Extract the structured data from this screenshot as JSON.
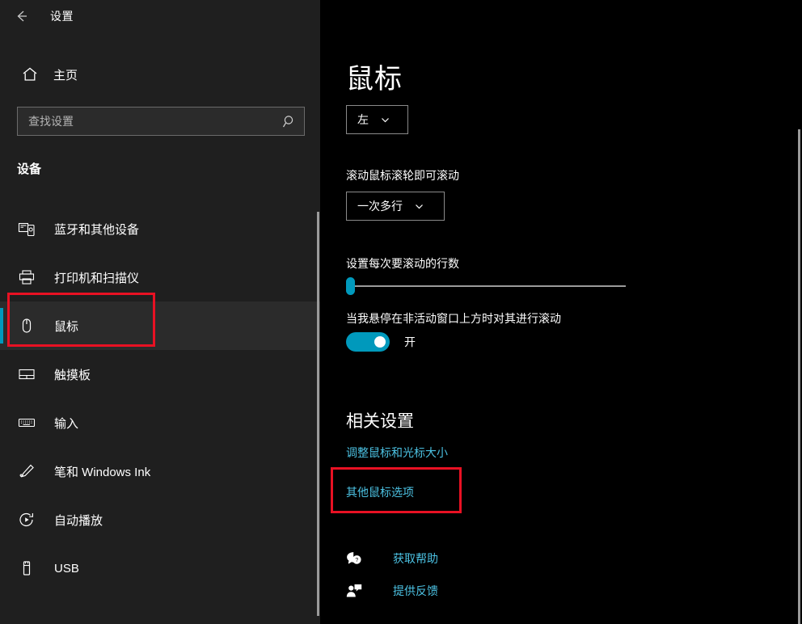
{
  "window": {
    "app_title": "设置",
    "back_icon": "back-arrow-icon",
    "controls": {
      "minimize": "minimize-icon",
      "maximize": "maximize-icon",
      "close": "close-icon"
    }
  },
  "sidebar": {
    "home": {
      "label": "主页",
      "icon": "home-icon"
    },
    "search": {
      "placeholder": "查找设置",
      "value": "",
      "icon": "search-icon"
    },
    "section_title": "设备",
    "items": [
      {
        "label": "蓝牙和其他设备",
        "icon": "bluetooth-devices-icon",
        "selected": false
      },
      {
        "label": "打印机和扫描仪",
        "icon": "printer-icon",
        "selected": false
      },
      {
        "label": "鼠标",
        "icon": "mouse-icon",
        "selected": true
      },
      {
        "label": "触摸板",
        "icon": "touchpad-icon",
        "selected": false
      },
      {
        "label": "输入",
        "icon": "keyboard-icon",
        "selected": false
      },
      {
        "label": "笔和 Windows Ink",
        "icon": "pen-icon",
        "selected": false
      },
      {
        "label": "自动播放",
        "icon": "autoplay-icon",
        "selected": false
      },
      {
        "label": "USB",
        "icon": "usb-icon",
        "selected": false
      }
    ]
  },
  "main": {
    "page_title": "鼠标",
    "primary_button": {
      "value": "左",
      "chevron": "chevron-down-icon"
    },
    "scroll_mouse_wheel": {
      "label": "滚动鼠标滚轮即可滚动",
      "value": "一次多行",
      "chevron": "chevron-down-icon"
    },
    "scroll_lines": {
      "label": "设置每次要滚动的行数",
      "slider_percent": 0
    },
    "inactive_window_scroll": {
      "label": "当我悬停在非活动窗口上方时对其进行滚动",
      "state": "开",
      "on": true
    },
    "related_settings": {
      "heading": "相关设置",
      "links": [
        "调整鼠标和光标大小",
        "其他鼠标选项"
      ]
    },
    "support": [
      {
        "label": "获取帮助",
        "icon": "help-question-icon"
      },
      {
        "label": "提供反馈",
        "icon": "feedback-person-icon"
      }
    ]
  },
  "colors": {
    "accent": "#0099bc",
    "link": "#4cc2e3",
    "annotation": "#e81123",
    "sidebar_bg": "#1f1f1f",
    "main_bg": "#000000"
  }
}
